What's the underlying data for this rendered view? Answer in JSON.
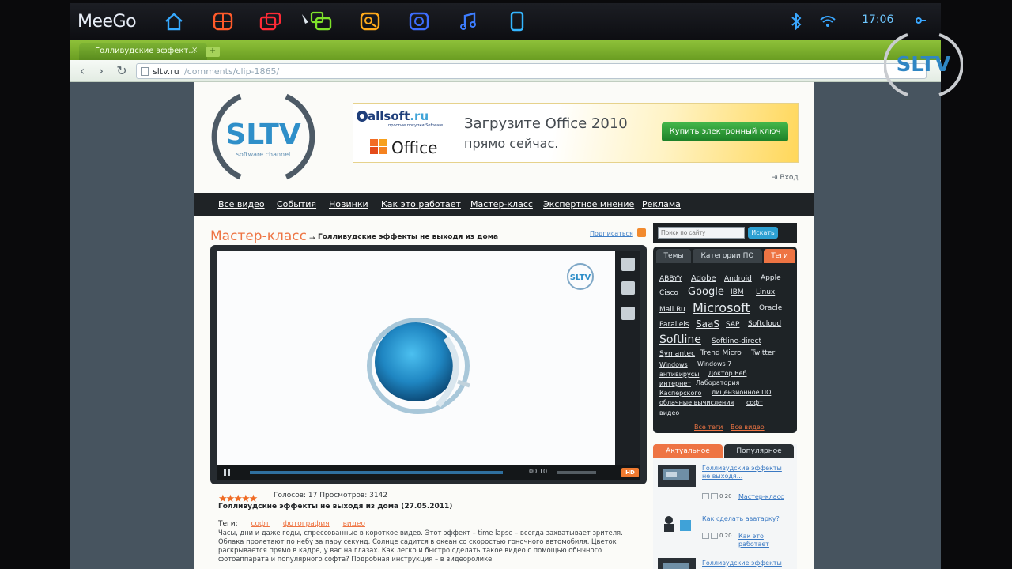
{
  "meego": {
    "logo": "MeeGo",
    "clock": "17:06",
    "launchers": [
      {
        "icon": "home-icon",
        "color": "#36a9ff"
      },
      {
        "icon": "apps-grid-icon",
        "color": "#ff5a2a"
      },
      {
        "icon": "tasks-icon",
        "color": "#ff2a36"
      },
      {
        "icon": "chat-icon",
        "color": "#7ee32a"
      },
      {
        "icon": "people-icon",
        "color": "#ffaa1a"
      },
      {
        "icon": "web-icon",
        "color": "#3d6dff"
      },
      {
        "icon": "music-icon",
        "color": "#3d7dff"
      },
      {
        "icon": "device-icon",
        "color": "#34b6ff"
      }
    ]
  },
  "browser": {
    "tab_title": "Голливудские эффект...",
    "tab_close": "×",
    "new_tab": "+",
    "back": "‹",
    "forward": "›",
    "reload": "↻",
    "address_host": "sltv.ru",
    "address_path": "/comments/clip-1865/"
  },
  "site": {
    "logo_text": "SLTV",
    "logo_sub": "software channel",
    "banner": {
      "brand": "allsoft",
      "brand_suffix": ".ru",
      "brand_sub": "простые покупки Software",
      "product": "Office",
      "line1": "Загрузите Office 2010",
      "line2": "прямо сейчас.",
      "cta": "Купить электронный ключ"
    },
    "login": "Вход",
    "nav": [
      "Все видео",
      "События",
      "Новинки",
      "Как это работает",
      "Мастер-класс",
      "Экспертное мнение",
      "Реклама"
    ],
    "section_title": "Мастер-класс",
    "section_arrow": "→",
    "section_video_title": "Голливудские эффекты не выходя из дома",
    "subscribe": "Подписаться",
    "player": {
      "watermark": "SLTV",
      "time": "00:10",
      "hd": "HD"
    },
    "rating": {
      "stars": 5,
      "votes_text": "Голосов: 17 Просмотров: 3142"
    },
    "video_date_title": "Голливудские эффекты не выходя из дома (27.05.2011)",
    "tags_label": "Теги:",
    "tags": [
      "софт",
      "фотография",
      "видео"
    ],
    "description": "Часы, дни и даже годы, спрессованные в короткое видео. Этот эффект – time lapse – всегда захватывает зрителя. Облака пролетают по небу за пару секунд. Солнце садится в океан со скоростью гоночного автомобиля. Цветок раскрывается прямо в кадре, у вас на глазах. Как легко и быстро сделать такое видео с помощью обычного фотоаппарата и популярного софта? Подробная инструкция – в видеоролике.",
    "search": {
      "placeholder": "Поиск по сайту",
      "button": "Искать"
    },
    "tags_widget": {
      "tabs": [
        "Темы",
        "Категории ПО",
        "Теги"
      ],
      "cloud": [
        "ABBYY",
        "Adobe",
        "Android",
        "Apple",
        "Cisco",
        "Google",
        "IBM",
        "Linux",
        "Mail.Ru",
        "Microsoft",
        "Oracle",
        "Parallels",
        "SaaS",
        "SAP",
        "Softcloud",
        "Softline",
        "Softline-direct",
        "Symantec",
        "Trend Micro",
        "Twitter",
        "Windows",
        "Windows 7",
        "антивирусы",
        "Доктор Веб",
        "интернет",
        "Лаборатория",
        "Касперского",
        "лицензионное ПО",
        "облачные вычисления",
        "софт",
        "видео"
      ],
      "footer_a": "Все теги",
      "footer_b": "Все видео"
    },
    "popular_widget": {
      "tab_actual": "Актуальное",
      "tab_popular": "Популярное",
      "items": [
        {
          "title": "Голливудские эффекты не выходя...",
          "meta": "0 20",
          "category": "Мастер-класс"
        },
        {
          "title": "Как сделать аватарку?",
          "meta": "0 20",
          "category": "Как это работает"
        },
        {
          "title": "Голливудские эффекты",
          "meta": "",
          "category": ""
        }
      ]
    }
  },
  "corner_logo": "SLTV"
}
